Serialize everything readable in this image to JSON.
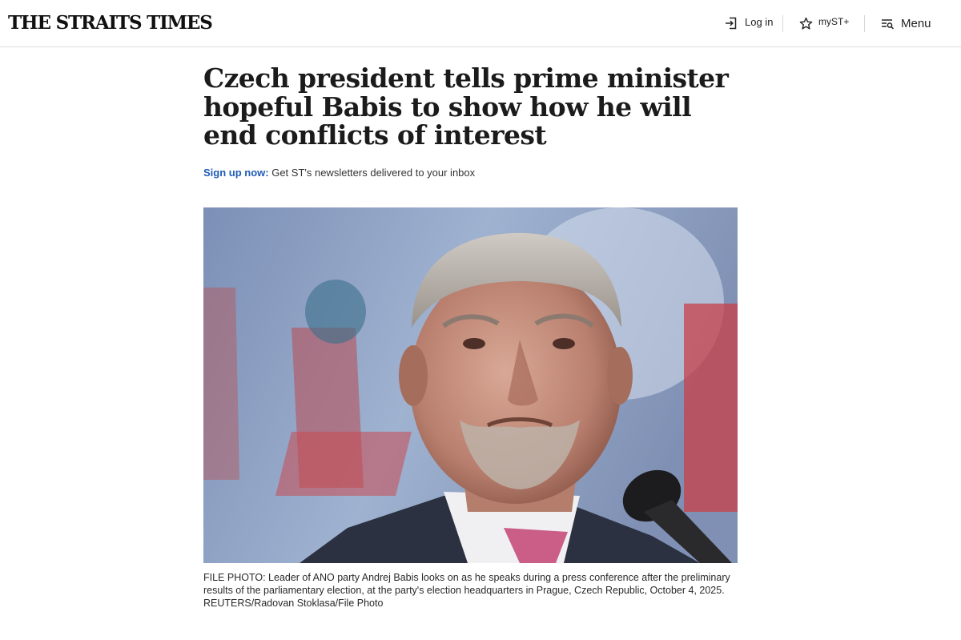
{
  "header": {
    "logo_text": "THE STRAITS TIMES",
    "login_label": "Log in",
    "myst_label": "myST+",
    "menu_label": "Menu"
  },
  "article": {
    "headline": "Czech president tells prime minister hopeful Babis to show how he will end conflicts of interest",
    "signup_link": "Sign up now:",
    "signup_text": " Get ST's newsletters delivered to your inbox",
    "photo_caption": "FILE PHOTO: Leader of ANO party Andrej Babis looks on as he speaks during a press conference after the preliminary results of the parliamentary election, at the party's election headquarters in Prague, Czech Republic, October 4, 2025. REUTERS/Radovan Stoklasa/File Photo"
  },
  "colors": {
    "link": "#1f5bb5",
    "text": "#1b1b1b",
    "divider": "#dcdcdc"
  },
  "icons": {
    "login": "login-icon",
    "myst": "star-icon",
    "menu": "menu-icon"
  }
}
